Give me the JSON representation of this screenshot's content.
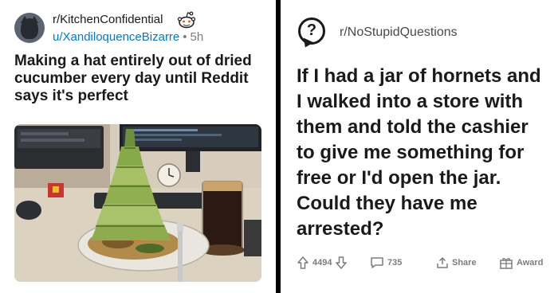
{
  "left_post": {
    "subreddit": "r/KitchenConfidential",
    "username": "u/XandiloquenceBizarre",
    "age": "5h",
    "title": "Making a hat entirely out of dried cucumber every day until Reddit says it's perfect"
  },
  "right_post": {
    "subreddit": "r/NoStupidQuestions",
    "title": "If I had a jar of hornets and I walked into a store with them and told the cashier to give me something for free or I'd open the jar. Could they have me arrested?",
    "upvotes": "4494",
    "comments": "735",
    "share_label": "Share",
    "award_label": "Award"
  },
  "colors": {
    "link_blue": "#0079d3",
    "text_dark": "#1a1a1b",
    "meta_gray": "#7c7c7c"
  }
}
